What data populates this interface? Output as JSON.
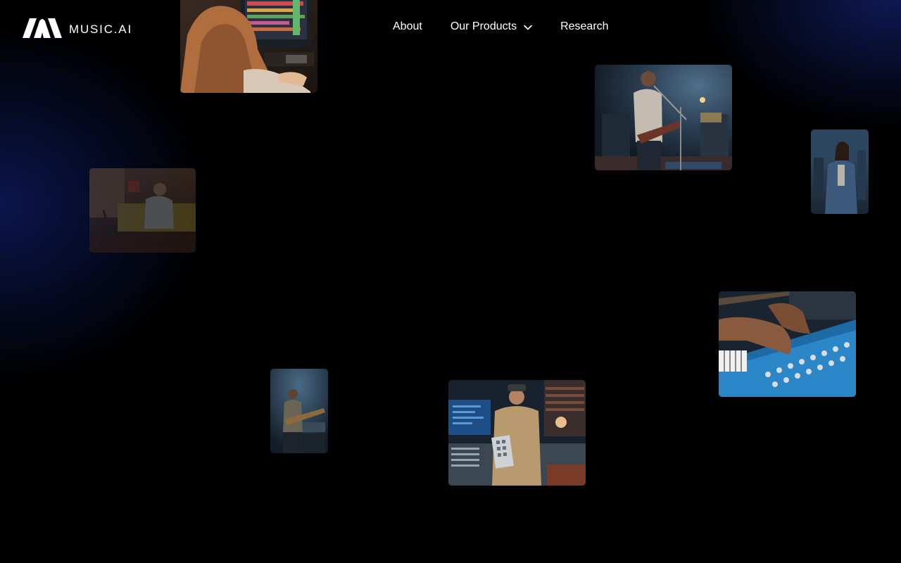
{
  "brand": {
    "name": "MUSIC.AI",
    "icon": "music-ai-logo-icon"
  },
  "nav": {
    "items": [
      {
        "label": "About",
        "has_dropdown": false
      },
      {
        "label": "Our Products",
        "has_dropdown": true
      },
      {
        "label": "Research",
        "has_dropdown": false
      }
    ]
  },
  "photos": [
    {
      "subject": "producer-at-daw-monitor"
    },
    {
      "subject": "guitarist-singing-at-microphone"
    },
    {
      "subject": "woman-in-denim-jacket-studio"
    },
    {
      "subject": "musician-in-living-room"
    },
    {
      "subject": "hands-on-synthesizer"
    },
    {
      "subject": "guitarist-with-pedalboard"
    },
    {
      "subject": "man-holding-sampler-at-mixing-desk"
    }
  ],
  "colors": {
    "background": "#000000",
    "glow": "#1a2e96",
    "text": "#ffffff"
  }
}
